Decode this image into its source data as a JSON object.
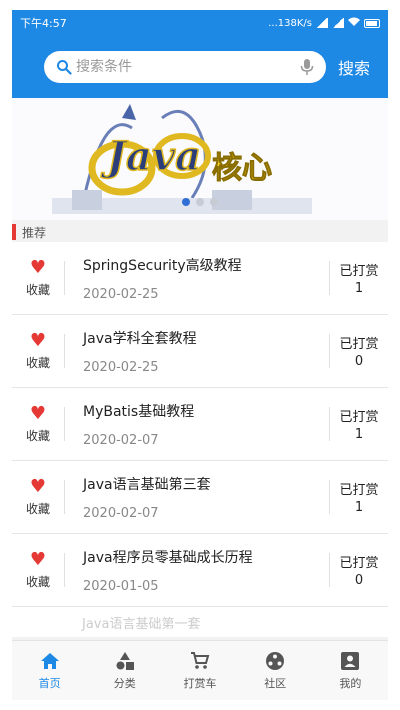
{
  "status": {
    "time": "下午4:57",
    "right": "...138K/s"
  },
  "search": {
    "placeholder": "搜索条件",
    "button": "搜索"
  },
  "banner": {
    "text": "Java 核心"
  },
  "section": {
    "title": "推荐"
  },
  "courses": [
    {
      "fav": "收藏",
      "title": "SpringSecurity高级教程",
      "date": "2020-02-25",
      "reward_label": "已打赏",
      "reward_count": "1"
    },
    {
      "fav": "收藏",
      "title": "Java学科全套教程",
      "date": "2020-02-25",
      "reward_label": "已打赏",
      "reward_count": "0"
    },
    {
      "fav": "收藏",
      "title": "MyBatis基础教程",
      "date": "2020-02-07",
      "reward_label": "已打赏",
      "reward_count": "1"
    },
    {
      "fav": "收藏",
      "title": "Java语言基础第三套",
      "date": "2020-02-07",
      "reward_label": "已打赏",
      "reward_count": "1"
    },
    {
      "fav": "收藏",
      "title": "Java程序员零基础成长历程",
      "date": "2020-01-05",
      "reward_label": "已打赏",
      "reward_count": "0"
    }
  ],
  "partial_row": {
    "title": "Java语言基础第一套"
  },
  "tabs": [
    {
      "label": "首页",
      "icon": "home-icon"
    },
    {
      "label": "分类",
      "icon": "category-icon"
    },
    {
      "label": "打赏车",
      "icon": "cart-icon"
    },
    {
      "label": "社区",
      "icon": "community-icon"
    },
    {
      "label": "我的",
      "icon": "profile-icon"
    }
  ],
  "colors": {
    "primary": "#1e88e5",
    "heart": "#e53935",
    "accent_bar": "#e53935"
  }
}
